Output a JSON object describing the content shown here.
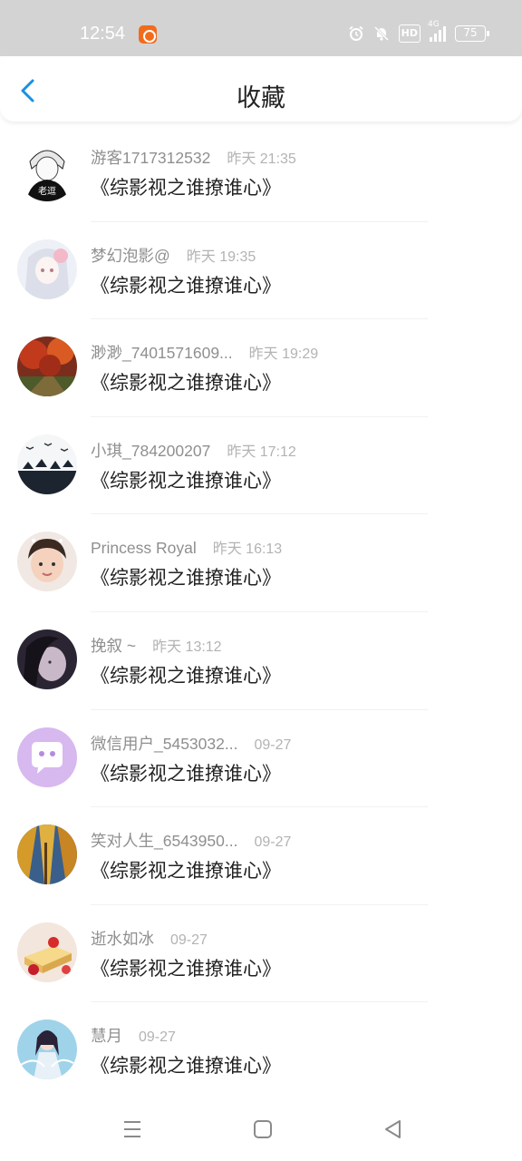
{
  "status_bar": {
    "time": "12:54",
    "hd": "HD",
    "network": "4G",
    "battery": "75",
    "icons": [
      "alarm-icon",
      "bell-off-icon",
      "hd-icon",
      "signal-icon",
      "battery-icon"
    ]
  },
  "header": {
    "title": "收藏",
    "back_icon": "chevron-left-icon",
    "accent_color": "#1a8fe3"
  },
  "items": [
    {
      "user": "游客1717312532",
      "time": "昨天 21:35",
      "title": "《综影视之谁撩谁心》",
      "avatar": "anime-character-avatar"
    },
    {
      "user": "梦幻泡影@",
      "time": "昨天 19:35",
      "title": "《综影视之谁撩谁心》",
      "avatar": "anime-girl-avatar"
    },
    {
      "user": "渺渺_7401571609...",
      "time": "昨天 19:29",
      "title": "《综影视之谁撩谁心》",
      "avatar": "autumn-trees-avatar"
    },
    {
      "user": "小琪_784200207",
      "time": "昨天 17:12",
      "title": "《综影视之谁撩谁心》",
      "avatar": "birds-avatar"
    },
    {
      "user": "Princess Royal",
      "time": "昨天 16:13",
      "title": "《综影视之谁撩谁心》",
      "avatar": "child-photo-avatar"
    },
    {
      "user": "挽叙 ~",
      "time": "昨天 13:12",
      "title": "《综影视之谁撩谁心》",
      "avatar": "dark-portrait-avatar"
    },
    {
      "user": "微信用户_5453032...",
      "time": "09-27",
      "title": "《综影视之谁撩谁心》",
      "avatar": "chat-bubble-avatar"
    },
    {
      "user": "笑对人生_6543950...",
      "time": "09-27",
      "title": "《综影视之谁撩谁心》",
      "avatar": "forest-avatar"
    },
    {
      "user": "逝水如冰",
      "time": "09-27",
      "title": "《综影视之谁撩谁心》",
      "avatar": "cake-avatar"
    },
    {
      "user": "慧月",
      "time": "09-27",
      "title": "《综影视之谁撩谁心》",
      "avatar": "fantasy-girl-avatar"
    }
  ],
  "system_nav": {
    "icons": [
      "menu-icon",
      "home-icon",
      "back-triangle-icon"
    ]
  }
}
